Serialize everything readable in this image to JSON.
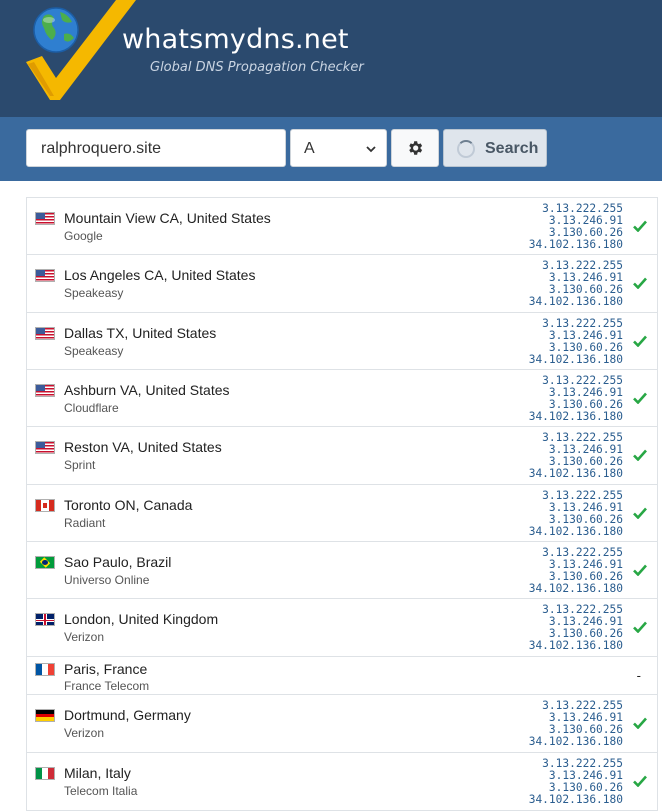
{
  "header": {
    "brand": "whatsmydns.net",
    "tagline": "Global DNS Propagation Checker",
    "icon": "globe-checkmark-logo"
  },
  "search": {
    "domain_value": "ralphroquero.site",
    "record_type": "A",
    "settings_icon": "gear-icon",
    "search_label": "Search",
    "search_icon": "spinner-icon"
  },
  "colors": {
    "header_bg": "#2b4a6e",
    "toolbar_bg": "#3a6a9e",
    "ip_text": "#2a5d8f",
    "check_green": "#28a745",
    "logo_yellow": "#f5b800"
  },
  "results": [
    {
      "location": "Mountain View CA, United States",
      "provider": "Google",
      "flag": "us",
      "ips": [
        "3.13.222.255",
        "3.13.246.91",
        "3.130.60.26",
        "34.102.136.180"
      ],
      "status": "check"
    },
    {
      "location": "Los Angeles CA, United States",
      "provider": "Speakeasy",
      "flag": "us",
      "ips": [
        "3.13.222.255",
        "3.13.246.91",
        "3.130.60.26",
        "34.102.136.180"
      ],
      "status": "check"
    },
    {
      "location": "Dallas TX, United States",
      "provider": "Speakeasy",
      "flag": "us",
      "ips": [
        "3.13.222.255",
        "3.13.246.91",
        "3.130.60.26",
        "34.102.136.180"
      ],
      "status": "check"
    },
    {
      "location": "Ashburn VA, United States",
      "provider": "Cloudflare",
      "flag": "us",
      "ips": [
        "3.13.222.255",
        "3.13.246.91",
        "3.130.60.26",
        "34.102.136.180"
      ],
      "status": "check"
    },
    {
      "location": "Reston VA, United States",
      "provider": "Sprint",
      "flag": "us",
      "ips": [
        "3.13.222.255",
        "3.13.246.91",
        "3.130.60.26",
        "34.102.136.180"
      ],
      "status": "check"
    },
    {
      "location": "Toronto ON, Canada",
      "provider": "Radiant",
      "flag": "ca",
      "ips": [
        "3.13.222.255",
        "3.13.246.91",
        "3.130.60.26",
        "34.102.136.180"
      ],
      "status": "check"
    },
    {
      "location": "Sao Paulo, Brazil",
      "provider": "Universo Online",
      "flag": "br",
      "ips": [
        "3.13.222.255",
        "3.13.246.91",
        "3.130.60.26",
        "34.102.136.180"
      ],
      "status": "check"
    },
    {
      "location": "London, United Kingdom",
      "provider": "Verizon",
      "flag": "gb",
      "ips": [
        "3.13.222.255",
        "3.13.246.91",
        "3.130.60.26",
        "34.102.136.180"
      ],
      "status": "check"
    },
    {
      "location": "Paris, France",
      "provider": "France Telecom",
      "flag": "fr",
      "ips": [],
      "status": "-"
    },
    {
      "location": "Dortmund, Germany",
      "provider": "Verizon",
      "flag": "de",
      "ips": [
        "3.13.222.255",
        "3.13.246.91",
        "3.130.60.26",
        "34.102.136.180"
      ],
      "status": "check"
    },
    {
      "location": "Milan, Italy",
      "provider": "Telecom Italia",
      "flag": "it",
      "ips": [
        "3.13.222.255",
        "3.13.246.91",
        "3.130.60.26",
        "34.102.136.180"
      ],
      "status": "check"
    }
  ]
}
